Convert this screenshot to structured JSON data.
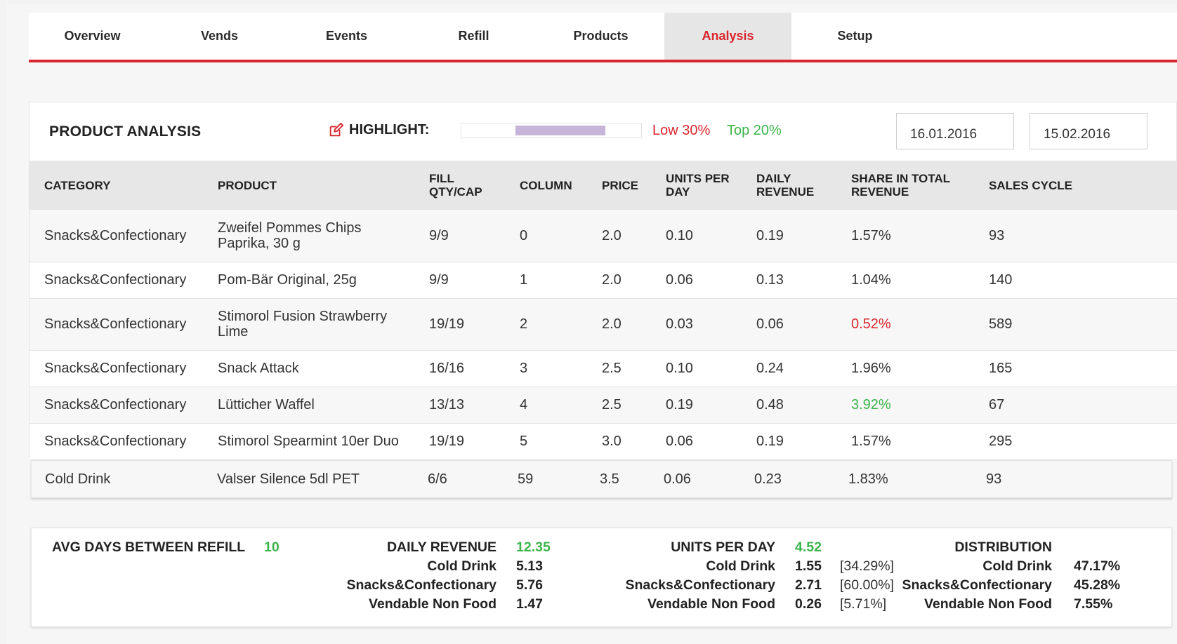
{
  "tabs": [
    {
      "label": "Overview"
    },
    {
      "label": "Vends"
    },
    {
      "label": "Events"
    },
    {
      "label": "Refill"
    },
    {
      "label": "Products"
    },
    {
      "label": "Analysis",
      "active": true
    },
    {
      "label": "Setup"
    }
  ],
  "analysis": {
    "title": "PRODUCT ANALYSIS",
    "highlight_label": "HIGHLIGHT:",
    "highlight_low_fraction": 0.3,
    "highlight_top_fraction": 0.2,
    "low_label": "Low 30%",
    "top_label": "Top 20%",
    "date_from": "16.01.2016",
    "date_to": "15.02.2016",
    "columns": [
      "CATEGORY",
      "PRODUCT",
      "FILL QTY/CAP",
      "COLUMN",
      "PRICE",
      "UNITS PER DAY",
      "DAILY REVENUE",
      "SHARE IN TOTAL REVENUE",
      "SALES CYCLE"
    ],
    "rows": [
      {
        "category": "Snacks&Confectionary",
        "product": "Zweifel Pommes Chips Paprika, 30 g",
        "fill": "9/9",
        "column": "0",
        "price": "2.0",
        "units": "0.10",
        "revenue": "0.19",
        "share": "1.57%",
        "cycle": "93"
      },
      {
        "category": "Snacks&Confectionary",
        "product": "Pom-Bär Original, 25g",
        "fill": "9/9",
        "column": "1",
        "price": "2.0",
        "units": "0.06",
        "revenue": "0.13",
        "share": "1.04%",
        "cycle": "140"
      },
      {
        "category": "Snacks&Confectionary",
        "product": "Stimorol Fusion Strawberry Lime",
        "fill": "19/19",
        "column": "2",
        "price": "2.0",
        "units": "0.03",
        "revenue": "0.06",
        "share": "0.52%",
        "cycle": "589"
      },
      {
        "category": "Snacks&Confectionary",
        "product": "Snack Attack",
        "fill": "16/16",
        "column": "3",
        "price": "2.5",
        "units": "0.10",
        "revenue": "0.24",
        "share": "1.96%",
        "cycle": "165"
      },
      {
        "category": "Snacks&Confectionary",
        "product": "Lütticher Waffel",
        "fill": "13/13",
        "column": "4",
        "price": "2.5",
        "units": "0.19",
        "revenue": "0.48",
        "share": "3.92%",
        "cycle": "67"
      },
      {
        "category": "Snacks&Confectionary",
        "product": "Stimorol Spearmint 10er Duo",
        "fill": "19/19",
        "column": "5",
        "price": "3.0",
        "units": "0.06",
        "revenue": "0.19",
        "share": "1.57%",
        "cycle": "295"
      }
    ],
    "extra_row": {
      "category": "Cold Drink",
      "product": "Valser Silence 5dl PET",
      "fill": "6/6",
      "column": "59",
      "price": "3.5",
      "units": "0.06",
      "revenue": "0.23",
      "share": "1.83%",
      "cycle": "93"
    }
  },
  "summary": {
    "avg_label": "AVG DAYS BETWEEN REFILL",
    "avg_value": "10",
    "daily_revenue": {
      "label": "DAILY REVENUE",
      "total": "12.35",
      "items": [
        {
          "label": "Cold Drink",
          "value": "5.13"
        },
        {
          "label": "Snacks&Confectionary",
          "value": "5.76"
        },
        {
          "label": "Vendable Non Food",
          "value": "1.47"
        }
      ]
    },
    "units_per_day": {
      "label": "UNITS PER DAY",
      "total": "4.52",
      "items": [
        {
          "label": "Cold Drink",
          "value": "1.55",
          "pct": "[34.29%]"
        },
        {
          "label": "Snacks&Confectionary",
          "value": "2.71",
          "pct": "[60.00%]"
        },
        {
          "label": "Vendable Non Food",
          "value": "0.26",
          "pct": "[5.71%]"
        }
      ]
    },
    "distribution": {
      "label": "DISTRIBUTION",
      "items": [
        {
          "label": "Cold Drink",
          "value": "47.17%"
        },
        {
          "label": "Snacks&Confectionary",
          "value": "45.28%"
        },
        {
          "label": "Vendable Non Food",
          "value": "7.55%"
        }
      ]
    }
  },
  "colors": {
    "accent": "#d9262e",
    "positive": "#3bb44a",
    "highlight_bar": "#c6b5d8"
  }
}
